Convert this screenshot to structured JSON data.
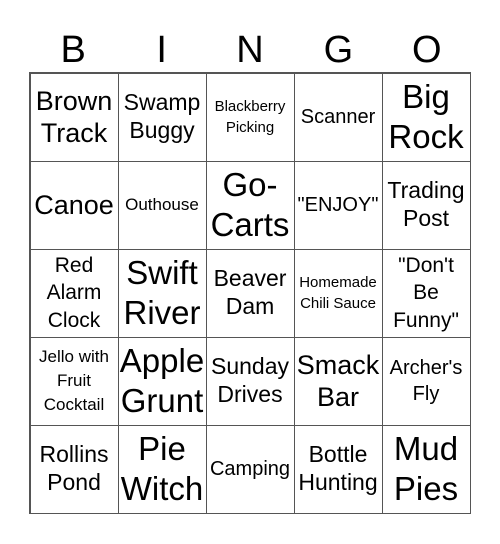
{
  "header": {
    "letters": [
      "B",
      "I",
      "N",
      "G",
      "O"
    ]
  },
  "grid": {
    "rows": [
      [
        "Brown Track",
        "Swamp Buggy",
        "Blackberry Picking",
        "Scanner",
        "Big Rock"
      ],
      [
        "Canoe",
        "Outhouse",
        "Go-Carts",
        "\"ENJOY\"",
        "Trading Post"
      ],
      [
        "Red Alarm Clock",
        "Swift River",
        "Beaver Dam",
        "Homemade Chili Sauce",
        "\"Don't Be Funny\""
      ],
      [
        "Jello with Fruit Cocktail",
        "Apple Grunt",
        "Sunday Drives",
        "Smack Bar",
        "Archer's Fly"
      ],
      [
        "Rollins Pond",
        "Pie Witch",
        "Camping",
        "Bottle Hunting",
        "Mud Pies"
      ]
    ]
  }
}
